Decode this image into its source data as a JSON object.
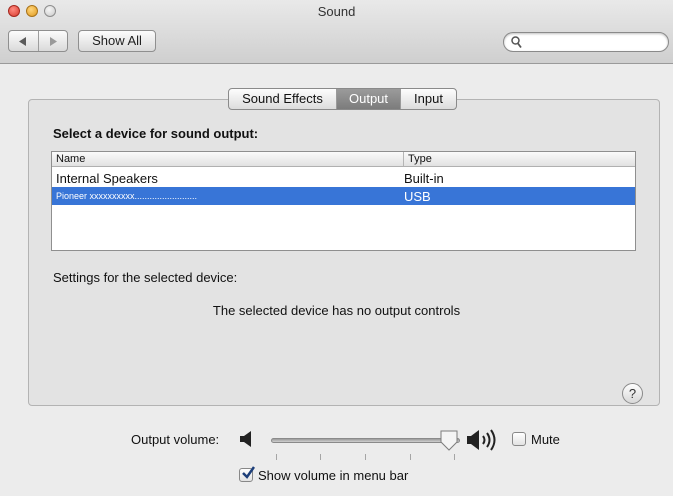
{
  "window": {
    "title": "Sound"
  },
  "toolbar": {
    "show_all_label": "Show All",
    "search_placeholder": "",
    "search_value": ""
  },
  "tabs": [
    {
      "label": "Sound Effects",
      "active": false
    },
    {
      "label": "Output",
      "active": true
    },
    {
      "label": "Input",
      "active": false
    }
  ],
  "output": {
    "select_label": "Select a device for sound output:",
    "columns": [
      "Name",
      "Type"
    ],
    "devices": [
      {
        "name": "Internal Speakers",
        "type": "Built-in",
        "selected": false
      },
      {
        "name": "Pioneer xxxxxxxxxx.........................",
        "type": "USB",
        "selected": true
      }
    ],
    "settings_label": "Settings for the selected device:",
    "no_controls_text": "The selected device has no output controls",
    "help_label": "?"
  },
  "volume": {
    "label": "Output volume:",
    "level_fraction": 0.9,
    "mute_label": "Mute",
    "mute_checked": false,
    "show_in_menu_bar_label": "Show volume in menu bar",
    "show_in_menu_bar_checked": true
  },
  "colors": {
    "selection": "#3875d7",
    "active_tab": "#8a8a8a"
  },
  "icons": {
    "back": "back-arrow-icon",
    "forward": "forward-arrow-icon",
    "search": "magnifier-icon",
    "speaker_low": "speaker-low-icon",
    "speaker_high": "speaker-high-icon",
    "help": "question-mark-icon"
  }
}
